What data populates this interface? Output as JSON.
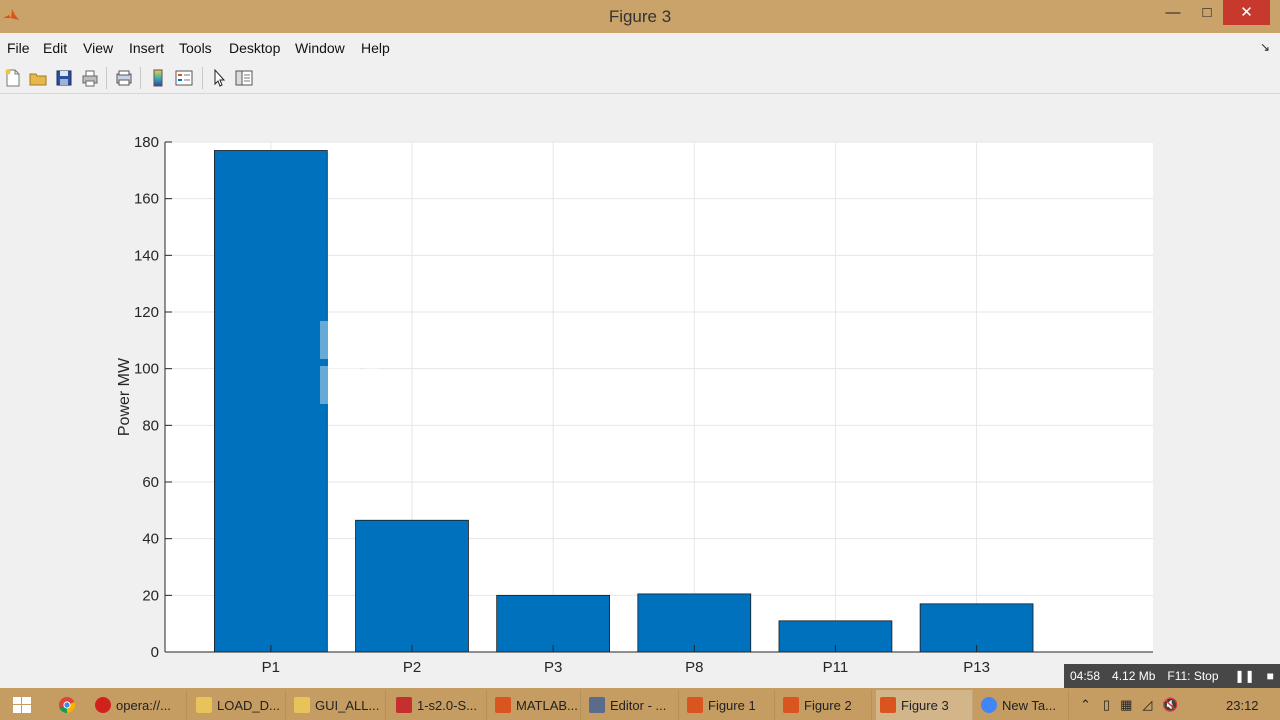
{
  "window": {
    "title": "Figure 3"
  },
  "window_buttons": {
    "minimize": "—",
    "maximize": "□",
    "close": "✕"
  },
  "menu": [
    "File",
    "Edit",
    "View",
    "Insert",
    "Tools",
    "Desktop",
    "Window",
    "Help"
  ],
  "toolbar": {
    "icons": [
      "new-figure-icon",
      "open-file-icon",
      "save-icon",
      "print-icon",
      "print-preview-icon",
      "colorbar-icon",
      "legend-icon",
      "edit-plot-icon",
      "property-editor-icon"
    ]
  },
  "colors": {
    "bar": "#0072bd",
    "titlebar": "#c9a36a",
    "taskbar": "#c59d63"
  },
  "chart_data": {
    "type": "bar",
    "categories": [
      "P1",
      "P2",
      "P3",
      "P8",
      "P11",
      "P13"
    ],
    "values": [
      177,
      46.5,
      20,
      20.5,
      11,
      17
    ],
    "title": "",
    "xlabel": "",
    "ylabel": "Power MW",
    "ylim": [
      0,
      180
    ],
    "yticks": [
      0,
      20,
      40,
      60,
      80,
      100,
      120,
      140,
      160,
      180
    ],
    "xlim": [
      0.25,
      7.25
    ],
    "grid": true
  },
  "overlay": {
    "elapsed": "04:58",
    "size": "4.12 Mb",
    "hotkey": "F11: Stop"
  },
  "taskbar": {
    "items": [
      {
        "label": "opera://...",
        "icon": "opera-icon"
      },
      {
        "label": "LOAD_D...",
        "icon": "folder-icon"
      },
      {
        "label": "GUI_ALL...",
        "icon": "folder-icon"
      },
      {
        "label": "1-s2.0-S...",
        "icon": "pdf-icon"
      },
      {
        "label": "MATLAB...",
        "icon": "matlab-icon"
      },
      {
        "label": "Editor - ...",
        "icon": "editor-icon"
      },
      {
        "label": "Figure 1",
        "icon": "matlab-figure-icon"
      },
      {
        "label": "Figure 2",
        "icon": "matlab-figure-icon"
      },
      {
        "label": "Figure 3",
        "icon": "matlab-figure-icon"
      },
      {
        "label": "New Ta...",
        "icon": "chrome-icon"
      }
    ],
    "clock": "23:12"
  }
}
